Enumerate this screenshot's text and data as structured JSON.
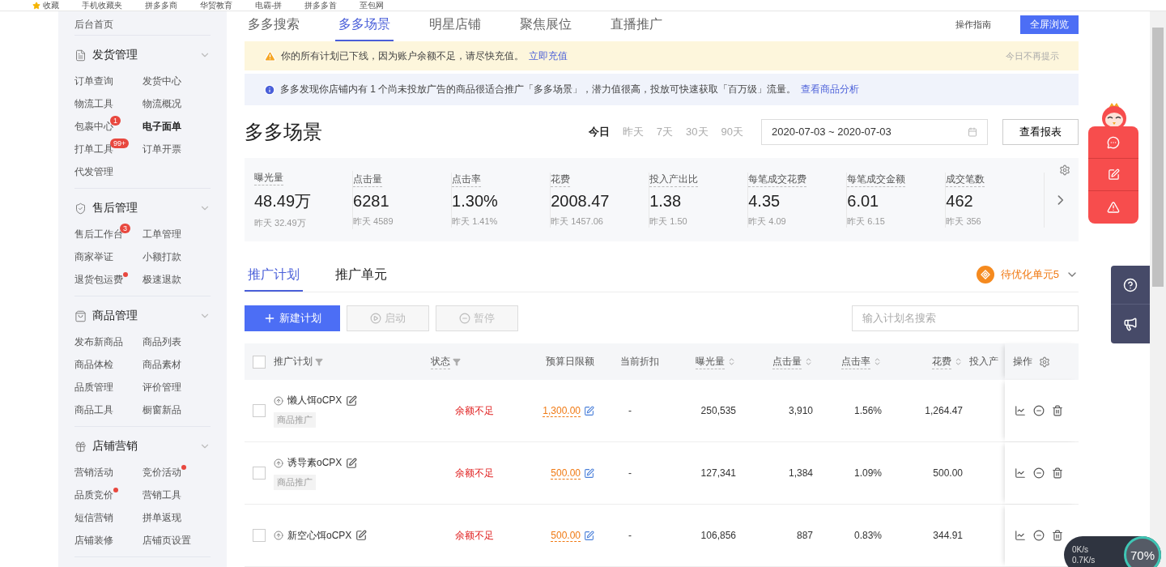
{
  "bookmarks": [
    {
      "label": "收藏"
    },
    {
      "label": "手机收藏夹"
    },
    {
      "label": "拼多多商"
    },
    {
      "label": "华贸教育"
    },
    {
      "label": "电霸-拼"
    },
    {
      "label": "拼多多首"
    },
    {
      "label": "至包网"
    }
  ],
  "sidebar": {
    "home": "后台首页",
    "groups": [
      {
        "title": "发货管理",
        "kind": "doc",
        "items": [
          {
            "label": "订单查询",
            "emphasized": false,
            "dot": false
          },
          {
            "label": "发货中心",
            "emphasized": false,
            "dot": false
          },
          {
            "label": "物流工具",
            "emphasized": false,
            "dot": false
          },
          {
            "label": "物流概况",
            "emphasized": false,
            "dot": false
          },
          {
            "label": "包裹中心",
            "badge": "1",
            "emphasized": false,
            "dot": false
          },
          {
            "label": "电子面单",
            "emphasized": true,
            "dot": false
          },
          {
            "label": "打单工具",
            "badge": "99+",
            "emphasized": false,
            "dot": false
          },
          {
            "label": "订单开票",
            "emphasized": false,
            "dot": false
          },
          {
            "label": "代发管理",
            "emphasized": false,
            "dot": false
          }
        ]
      },
      {
        "title": "售后管理",
        "kind": "shield",
        "items": [
          {
            "label": "售后工作台",
            "badge": "3",
            "emphasized": false,
            "dot": false
          },
          {
            "label": "工单管理",
            "emphasized": false,
            "dot": false
          },
          {
            "label": "商家举证",
            "emphasized": false,
            "dot": false
          },
          {
            "label": "小额打款",
            "emphasized": false,
            "dot": false
          },
          {
            "label": "退货包运费",
            "emphasized": false,
            "dot": true
          },
          {
            "label": "极速退款",
            "emphasized": false,
            "dot": false
          }
        ]
      },
      {
        "title": "商品管理",
        "kind": "bag",
        "items": [
          {
            "label": "发布新商品",
            "emphasized": false,
            "dot": false
          },
          {
            "label": "商品列表",
            "emphasized": false,
            "dot": false
          },
          {
            "label": "商品体检",
            "emphasized": false,
            "dot": false
          },
          {
            "label": "商品素材",
            "emphasized": false,
            "dot": false
          },
          {
            "label": "品质管理",
            "emphasized": false,
            "dot": false
          },
          {
            "label": "评价管理",
            "emphasized": false,
            "dot": false
          },
          {
            "label": "商品工具",
            "emphasized": false,
            "dot": false
          },
          {
            "label": "橱窗新品",
            "emphasized": false,
            "dot": false
          }
        ]
      },
      {
        "title": "店铺营销",
        "kind": "gift",
        "items": [
          {
            "label": "营销活动",
            "emphasized": false,
            "dot": false
          },
          {
            "label": "竞价活动",
            "emphasized": false,
            "dot": true
          },
          {
            "label": "品质竞价",
            "emphasized": false,
            "dot": true
          },
          {
            "label": "营销工具",
            "emphasized": false,
            "dot": false
          },
          {
            "label": "短信营销",
            "emphasized": false,
            "dot": false
          },
          {
            "label": "拼单返现",
            "emphasized": false,
            "dot": false
          },
          {
            "label": "店铺装修",
            "emphasized": false,
            "dot": false
          },
          {
            "label": "店铺页设置",
            "emphasized": false,
            "dot": false
          }
        ]
      }
    ]
  },
  "tabs": [
    {
      "label": "多多搜索",
      "selected": false
    },
    {
      "label": "多多场景",
      "selected": true
    },
    {
      "label": "明星店铺",
      "selected": false
    },
    {
      "label": "聚焦展位",
      "selected": false
    },
    {
      "label": "直播推广",
      "selected": false
    }
  ],
  "guide_link": "操作指南",
  "fullscreen_button": "全屏浏览",
  "warning": {
    "text": "你的所有计划已下线，因为账户余额不足，请尽快充值。",
    "link": "立即充值",
    "dismiss": "今日不再提示"
  },
  "info": {
    "text": "多多发现你店铺内有 1 个尚未投放广告的商品很适合推广「多多场景」，潜力值很高，投放可快速获取「百万级」流量。",
    "link": "查看商品分析"
  },
  "page_title": "多多场景",
  "ranges": [
    {
      "label": "今日",
      "selected": true
    },
    {
      "label": "昨天",
      "selected": false
    },
    {
      "label": "7天",
      "selected": false
    },
    {
      "label": "30天",
      "selected": false
    },
    {
      "label": "90天",
      "selected": false
    }
  ],
  "date_range": "2020-07-03 ~ 2020-07-03",
  "report_button": "查看报表",
  "metrics": [
    {
      "label": "曝光量",
      "value": "48.49万",
      "yesterday": "昨天 32.49万"
    },
    {
      "label": "点击量",
      "value": "6281",
      "yesterday": "昨天 4589"
    },
    {
      "label": "点击率",
      "value": "1.30%",
      "yesterday": "昨天 1.41%"
    },
    {
      "label": "花费",
      "value": "2008.47",
      "yesterday": "昨天 1457.06"
    },
    {
      "label": "投入产出比",
      "value": "1.38",
      "yesterday": "昨天 1.50"
    },
    {
      "label": "每笔成交花费",
      "value": "4.35",
      "yesterday": "昨天 4.09"
    },
    {
      "label": "每笔成交金额",
      "value": "6.01",
      "yesterday": "昨天 6.15"
    },
    {
      "label": "成交笔数",
      "value": "462",
      "yesterday": "昨天 356"
    }
  ],
  "subtabs": [
    {
      "label": "推广计划",
      "selected": true
    },
    {
      "label": "推广单元",
      "selected": false
    }
  ],
  "optimize": "待优化单元5",
  "toolbar": [
    {
      "kind": "primary",
      "label": "新建计划",
      "disabled": false
    },
    {
      "kind": "start",
      "label": "启动",
      "disabled": true
    },
    {
      "kind": "pause",
      "label": "暂停",
      "disabled": true
    }
  ],
  "search": {
    "placeholder": "输入计划名搜索"
  },
  "table": {
    "columns": [
      {
        "label": "推广计划",
        "kind": "filter"
      },
      {
        "label": "状态",
        "kind": "filter"
      },
      {
        "label": "预算日限额",
        "kind": "plain"
      },
      {
        "label": "当前折扣",
        "kind": "plain"
      },
      {
        "label": "曝光量",
        "kind": "sort"
      },
      {
        "label": "点击量",
        "kind": "sort"
      },
      {
        "label": "点击率",
        "kind": "sort"
      },
      {
        "label": "花费",
        "kind": "sort"
      },
      {
        "label": "投入产",
        "kind": "plain"
      }
    ],
    "actions_label": "操作",
    "select_all_checked": false,
    "rows": [
      {
        "checked": false,
        "name": "懒人饵oCPX",
        "tag": "商品推广",
        "status": "余额不足",
        "budget": "1,300.00",
        "discount": "-",
        "impressions": "250,535",
        "clicks": "3,910",
        "ctr": "1.56%",
        "spend": "1,264.47"
      },
      {
        "checked": false,
        "name": "诱导素oCPX",
        "tag": "商品推广",
        "status": "余额不足",
        "budget": "500.00",
        "discount": "-",
        "impressions": "127,341",
        "clicks": "1,384",
        "ctr": "1.09%",
        "spend": "500.00"
      },
      {
        "checked": false,
        "name": "新空心饵oCPX",
        "status": "余额不足",
        "budget": "500.00",
        "discount": "-",
        "impressions": "106,856",
        "clicks": "887",
        "ctr": "0.83%",
        "spend": "344.91"
      }
    ]
  },
  "network": {
    "up": "0K/s",
    "down": "0.7K/s",
    "percent": "70%"
  }
}
